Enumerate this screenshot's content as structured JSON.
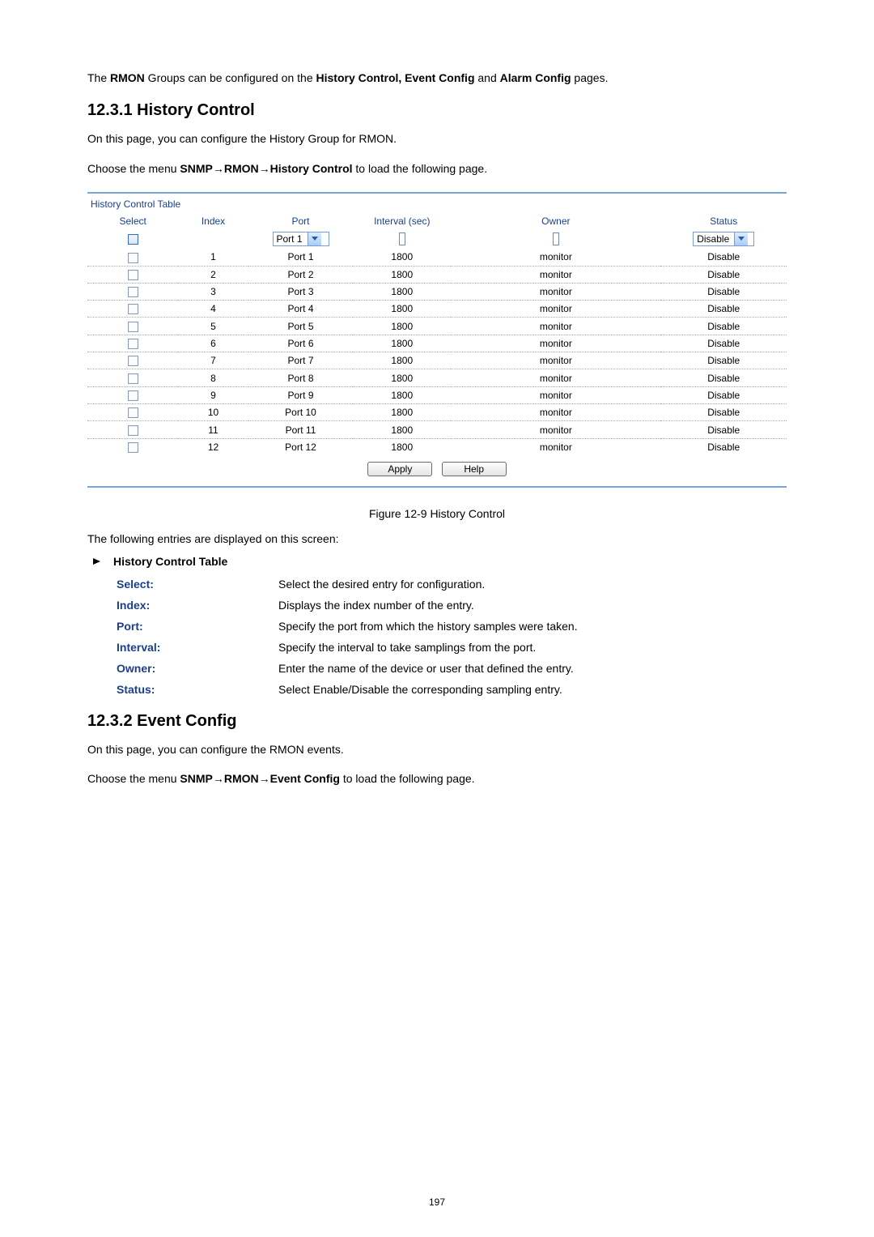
{
  "intro": {
    "prefix": "The ",
    "rmon": "RMON",
    "middle": " Groups can be configured on the ",
    "boldpart": "History Control, Event Config",
    "and": " and ",
    "alarm": "Alarm Config",
    "suffix": " pages."
  },
  "section_history": {
    "heading": "12.3.1  History Control",
    "p1": "On this page, you can configure the History Group for RMON.",
    "p2_prefix": "Choose the menu ",
    "p2_bold": "SNMP→RMON→History Control",
    "p2_suffix": " to load the following page."
  },
  "panel": {
    "title": "History Control Table",
    "headers": {
      "select": "Select",
      "index": "Index",
      "port": "Port",
      "interval": "Interval (sec)",
      "owner": "Owner",
      "status": "Status"
    },
    "filter": {
      "port": "Port 1",
      "status": "Disable"
    },
    "rows": [
      {
        "index": "1",
        "port": "Port 1",
        "interval": "1800",
        "owner": "monitor",
        "status": "Disable"
      },
      {
        "index": "2",
        "port": "Port 2",
        "interval": "1800",
        "owner": "monitor",
        "status": "Disable"
      },
      {
        "index": "3",
        "port": "Port 3",
        "interval": "1800",
        "owner": "monitor",
        "status": "Disable"
      },
      {
        "index": "4",
        "port": "Port 4",
        "interval": "1800",
        "owner": "monitor",
        "status": "Disable"
      },
      {
        "index": "5",
        "port": "Port 5",
        "interval": "1800",
        "owner": "monitor",
        "status": "Disable"
      },
      {
        "index": "6",
        "port": "Port 6",
        "interval": "1800",
        "owner": "monitor",
        "status": "Disable"
      },
      {
        "index": "7",
        "port": "Port 7",
        "interval": "1800",
        "owner": "monitor",
        "status": "Disable"
      },
      {
        "index": "8",
        "port": "Port 8",
        "interval": "1800",
        "owner": "monitor",
        "status": "Disable"
      },
      {
        "index": "9",
        "port": "Port 9",
        "interval": "1800",
        "owner": "monitor",
        "status": "Disable"
      },
      {
        "index": "10",
        "port": "Port 10",
        "interval": "1800",
        "owner": "monitor",
        "status": "Disable"
      },
      {
        "index": "11",
        "port": "Port 11",
        "interval": "1800",
        "owner": "monitor",
        "status": "Disable"
      },
      {
        "index": "12",
        "port": "Port 12",
        "interval": "1800",
        "owner": "monitor",
        "status": "Disable"
      }
    ],
    "buttons": {
      "apply": "Apply",
      "help": "Help"
    }
  },
  "caption": "Figure 12-9 History Control",
  "entries_intro": "The following entries are displayed on this screen:",
  "bullet_label": "History Control Table",
  "defs": [
    {
      "term": "Select:",
      "desc": "Select the desired entry for configuration."
    },
    {
      "term": "Index:",
      "desc": "Displays the index number of the entry."
    },
    {
      "term": "Port:",
      "desc": "Specify the port from which the history samples were taken."
    },
    {
      "term": "Interval:",
      "desc": "Specify the interval to take samplings from the port."
    },
    {
      "term": "Owner:",
      "desc": "Enter the name of the device or user that defined the entry."
    },
    {
      "term": "Status:",
      "desc": "Select Enable/Disable the corresponding sampling entry."
    }
  ],
  "section_event": {
    "heading": "12.3.2  Event Config",
    "p1": "On this page, you can configure the RMON events.",
    "p2_prefix": "Choose the menu ",
    "p2_bold": "SNMP→RMON→Event Config",
    "p2_suffix": " to load the following page."
  },
  "page_number": "197"
}
